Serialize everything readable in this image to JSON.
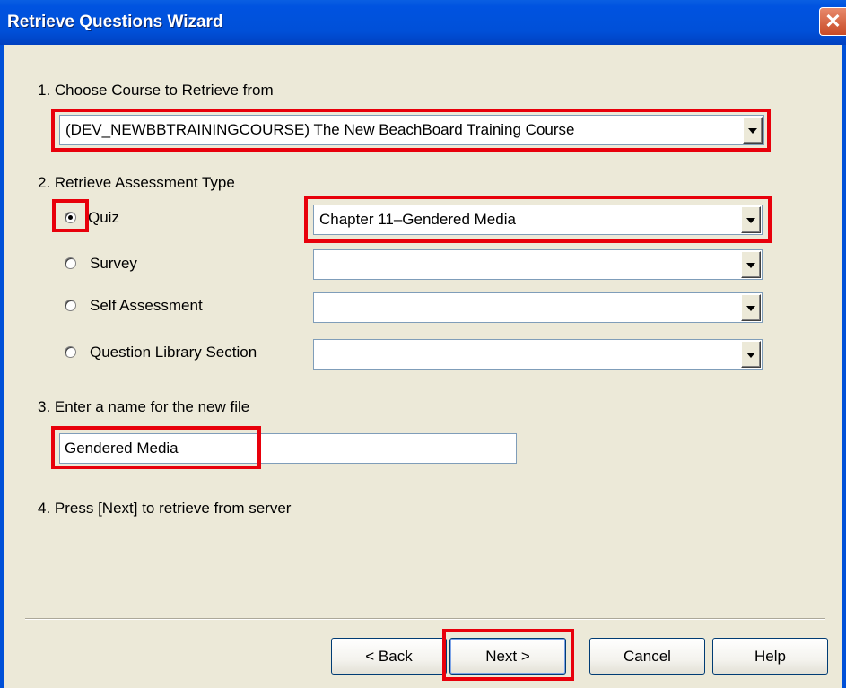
{
  "window": {
    "title": "Retrieve Questions Wizard",
    "close_glyph": "✕"
  },
  "step1": {
    "label": "1.  Choose Course to Retrieve from",
    "course_value": "(DEV_NEWBBTRAININGCOURSE) The New BeachBoard Training Course"
  },
  "step2": {
    "label": "2.  Retrieve Assessment Type",
    "options": [
      {
        "label": "Quiz",
        "selected": true,
        "dropdown_value": "Chapter 11–Gendered Media"
      },
      {
        "label": "Survey",
        "selected": false,
        "dropdown_value": ""
      },
      {
        "label": "Self Assessment",
        "selected": false,
        "dropdown_value": ""
      },
      {
        "label": "Question Library Section",
        "selected": false,
        "dropdown_value": ""
      }
    ]
  },
  "step3": {
    "label": "3.  Enter a name for the new file",
    "filename_value": "Gendered Media"
  },
  "step4": {
    "label": "4.  Press [Next] to retrieve from server"
  },
  "buttons": {
    "back": "< Back",
    "next": "Next >",
    "cancel": "Cancel",
    "help": "Help"
  },
  "colors": {
    "highlight": "#e8000b",
    "titlebar": "#0050d8",
    "dialog_bg": "#ece9d8"
  }
}
